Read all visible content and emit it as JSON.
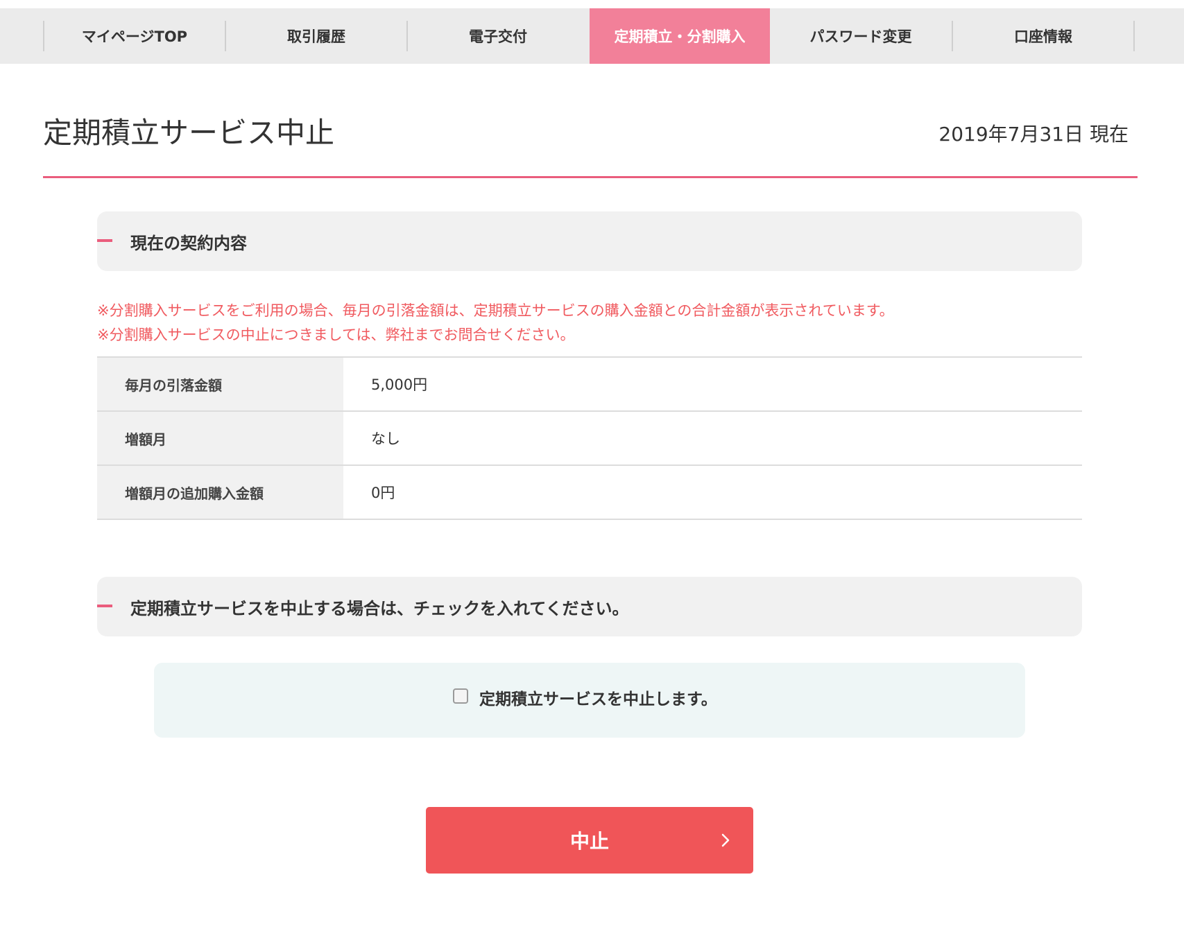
{
  "nav": {
    "items": [
      {
        "label": "マイページTOP",
        "active": false
      },
      {
        "label": "取引履歴",
        "active": false
      },
      {
        "label": "電子交付",
        "active": false
      },
      {
        "label": "定期積立・分割購入",
        "active": true
      },
      {
        "label": "パスワード変更",
        "active": false
      },
      {
        "label": "口座情報",
        "active": false
      }
    ]
  },
  "header": {
    "title": "定期積立サービス中止",
    "as_of": "2019年7月31日 現在"
  },
  "contract": {
    "heading": "現在の契約内容",
    "notes": [
      "※分割購入サービスをご利用の場合、毎月の引落金額は、定期積立サービスの購入金額との合計金額が表示されています。",
      "※分割購入サービスの中止につきましては、弊社までお問合せください。"
    ],
    "rows": [
      {
        "label": "毎月の引落金額",
        "value": "5,000円"
      },
      {
        "label": "増額月",
        "value": "なし"
      },
      {
        "label": "増額月の追加購入金額",
        "value": "0円"
      }
    ]
  },
  "cancel": {
    "heading": "定期積立サービスを中止する場合は、チェックを入れてください。",
    "checkbox_label": "定期積立サービスを中止します。",
    "checkbox_checked": false,
    "button_label": "中止"
  },
  "colors": {
    "accent_pink": "#ea5d7d",
    "active_tab": "#f28099",
    "note_red": "#f05a5f",
    "button_red": "#f05558"
  }
}
